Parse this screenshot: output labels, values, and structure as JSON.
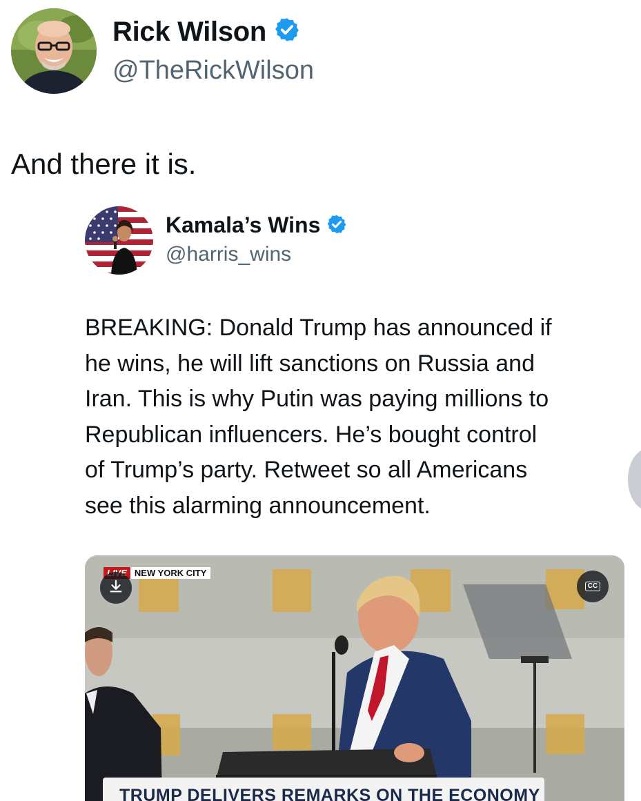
{
  "tweet": {
    "author": {
      "name": "Rick Wilson",
      "handle": "@TheRickWilson",
      "verified": true,
      "avatar": "profile-photo"
    },
    "text": "And there it is."
  },
  "quoted_tweet": {
    "author": {
      "name": "Kamala’s Wins",
      "handle": "@harris_wins",
      "verified": true,
      "avatar": "profile-photo-flag"
    },
    "text_lines": [
      "BREAKING: Donald Trump has announced if",
      "he wins, he will lift sanctions on Russia and",
      "Iran. This is why Putin was paying millions to",
      "Republican influencers. He’s bought control",
      "of Trump’s party. Retweet so all Americans",
      "see this alarming announcement."
    ],
    "media": {
      "live_label": "LIVE",
      "location_label": "NEW YORK CITY",
      "cc_label": "CC",
      "headline": "TRUMP DELIVERS REMARKS ON THE ECONOMY",
      "download_icon": "download-icon"
    }
  },
  "colors": {
    "verified_blue": "#1d9bf0",
    "handle_gray": "#536471",
    "live_red": "#c21a1a"
  }
}
